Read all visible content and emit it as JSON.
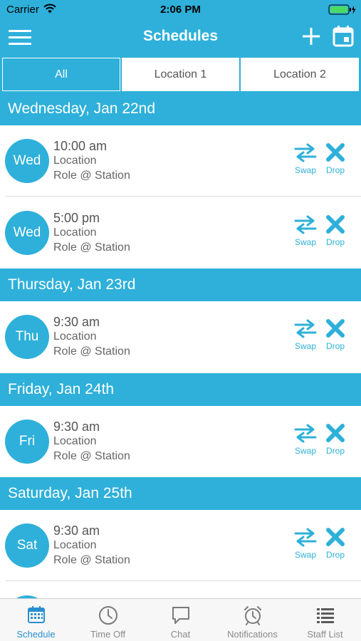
{
  "status_bar": {
    "carrier": "Carrier",
    "time": "2:06 PM"
  },
  "nav": {
    "title": "Schedules"
  },
  "tabs": [
    {
      "label": "All",
      "active": true
    },
    {
      "label": "Location 1",
      "active": false
    },
    {
      "label": "Location 2",
      "active": false
    }
  ],
  "actions": {
    "swap_label": "Swap",
    "drop_label": "Drop"
  },
  "days": [
    {
      "header": "Wednesday, Jan 22nd",
      "shifts": [
        {
          "badge": "Wed",
          "time": "10:00 am",
          "location": "Location",
          "role": "Role @ Station"
        },
        {
          "badge": "Wed",
          "time": "5:00 pm",
          "location": "Location",
          "role": "Role @ Station"
        }
      ]
    },
    {
      "header": "Thursday, Jan 23rd",
      "shifts": [
        {
          "badge": "Thu",
          "time": "9:30 am",
          "location": "Location",
          "role": "Role @ Station"
        }
      ]
    },
    {
      "header": "Friday, Jan 24th",
      "shifts": [
        {
          "badge": "Fri",
          "time": "9:30 am",
          "location": "Location",
          "role": "Role @ Station"
        }
      ]
    },
    {
      "header": "Saturday, Jan 25th",
      "shifts": [
        {
          "badge": "Sat",
          "time": "9:30 am",
          "location": "Location",
          "role": "Role @ Station"
        }
      ]
    }
  ],
  "tab_bar": [
    {
      "label": "Schedule",
      "icon": "calendar-grid-icon",
      "active": true
    },
    {
      "label": "Time Off",
      "icon": "clock-icon",
      "active": false
    },
    {
      "label": "Chat",
      "icon": "chat-bubble-icon",
      "active": false
    },
    {
      "label": "Notifications",
      "icon": "alarm-clock-icon",
      "active": false
    },
    {
      "label": "Staff List",
      "icon": "list-icon",
      "active": false
    }
  ],
  "colors": {
    "accent": "#2eb0da",
    "tab_active": "#2a8fd0",
    "battery": "#4cd964"
  }
}
